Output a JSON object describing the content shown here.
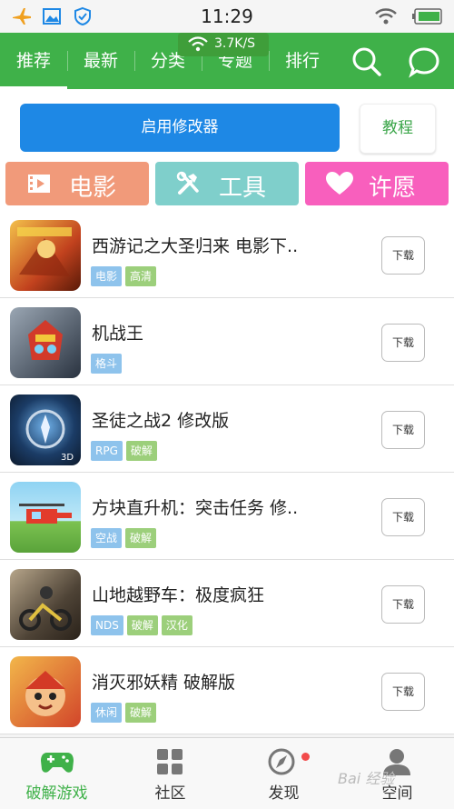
{
  "status_bar": {
    "time": "11:29"
  },
  "network_toast": {
    "speed": "3.7K/S"
  },
  "top_nav": {
    "tabs": [
      {
        "label": "推荐",
        "active": true
      },
      {
        "label": "最新"
      },
      {
        "label": "分类"
      },
      {
        "label": "专题"
      },
      {
        "label": "排行"
      }
    ],
    "icons": [
      "search-icon",
      "message-icon"
    ]
  },
  "actions": {
    "enable_modifier": "启用修改器",
    "tutorial": "教程"
  },
  "categories": [
    {
      "label": "电影",
      "icon": "film-icon",
      "color": "#f19a7a"
    },
    {
      "label": "工具",
      "icon": "tools-icon",
      "color": "#7fcfcb"
    },
    {
      "label": "许愿",
      "icon": "heart-icon",
      "color": "#f85fbd"
    }
  ],
  "apps": [
    {
      "name": "西游记之大圣归来 电影下..",
      "tags": [
        {
          "text": "电影",
          "color": "blue"
        },
        {
          "text": "高清",
          "color": "green"
        }
      ],
      "download": "下载"
    },
    {
      "name": "机战王",
      "tags": [
        {
          "text": "格斗",
          "color": "blue"
        }
      ],
      "download": "下载"
    },
    {
      "name": "圣徒之战2 修改版",
      "tags": [
        {
          "text": "RPG",
          "color": "blue"
        },
        {
          "text": "破解",
          "color": "green"
        }
      ],
      "download": "下载"
    },
    {
      "name": "方块直升机：突击任务 修..",
      "tags": [
        {
          "text": "空战",
          "color": "blue"
        },
        {
          "text": "破解",
          "color": "green"
        }
      ],
      "download": "下载"
    },
    {
      "name": "山地越野车：极度疯狂",
      "tags": [
        {
          "text": "NDS",
          "color": "blue"
        },
        {
          "text": "破解",
          "color": "green"
        },
        {
          "text": "汉化",
          "color": "green"
        }
      ],
      "download": "下载"
    },
    {
      "name": "消灭邪妖精 破解版",
      "tags": [
        {
          "text": "休闲",
          "color": "blue"
        },
        {
          "text": "破解",
          "color": "green"
        }
      ],
      "download": "下载"
    }
  ],
  "bottom_nav": [
    {
      "label": "破解游戏",
      "icon": "gamepad-icon",
      "active": true
    },
    {
      "label": "社区",
      "icon": "grid-icon"
    },
    {
      "label": "发现",
      "icon": "compass-icon",
      "badge": true
    },
    {
      "label": "空间",
      "icon": "user-icon"
    }
  ],
  "watermark": "Bai 经验",
  "colors": {
    "brand": "#3fb149",
    "primary_button": "#1e88e5"
  }
}
